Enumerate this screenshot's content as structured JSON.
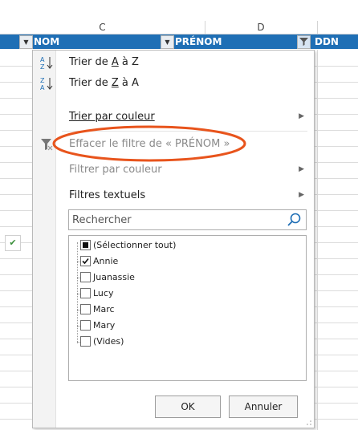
{
  "columns": {
    "c": "C",
    "d": "D"
  },
  "table_headers": {
    "nom": "NOM",
    "prenom": "PRÉNOM",
    "ddn": "DDN"
  },
  "menu": {
    "sort_az": {
      "pre": "Trier de ",
      "a": "A",
      "mid": " à ",
      "z": "Z"
    },
    "sort_za": {
      "pre": "Trier de ",
      "z": "Z",
      "mid": " à ",
      "a": "A"
    },
    "sort_color": "Trier par couleur",
    "clear_filter": "Effacer le filtre de « PRÉNOM »",
    "filter_color": "Filtrer par couleur",
    "text_filters": "Filtres textuels"
  },
  "search": {
    "placeholder": "Rechercher"
  },
  "list": [
    {
      "label": "(Sélectionner tout)",
      "state": "partial"
    },
    {
      "label": "Annie",
      "state": "checked"
    },
    {
      "label": "Juanassie",
      "state": "unchecked"
    },
    {
      "label": "Lucy",
      "state": "unchecked"
    },
    {
      "label": "Marc",
      "state": "unchecked"
    },
    {
      "label": "Mary",
      "state": "unchecked"
    },
    {
      "label": "(Vides)",
      "state": "unchecked"
    }
  ],
  "buttons": {
    "ok": "OK",
    "cancel": "Annuler"
  },
  "colors": {
    "header_blue": "#1f6fb5",
    "annotation_red": "#e8541c",
    "check_green": "#3a8f3a"
  }
}
